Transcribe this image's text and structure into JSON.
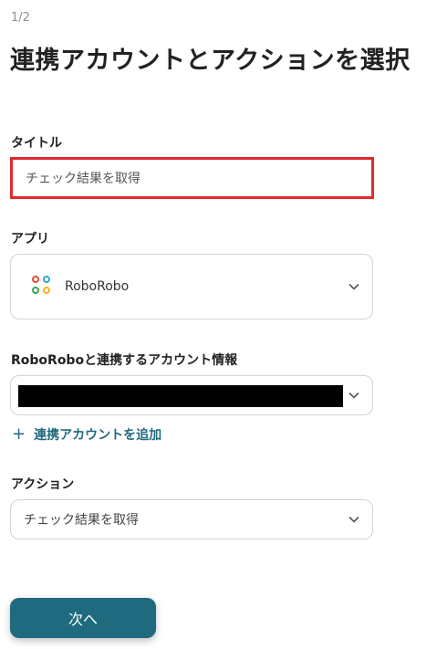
{
  "step_indicator": "1/2",
  "page_title": "連携アカウントとアクションを選択",
  "title_field": {
    "label": "タイトル",
    "value": "チェック結果を取得"
  },
  "app_field": {
    "label": "アプリ",
    "selected": "RoboRobo",
    "icon": "roborobo-logo-icon"
  },
  "account_field": {
    "label": "RoboRoboと連携するアカウント情報",
    "value_masked": true
  },
  "add_account_link": {
    "label": "連携アカウントを追加",
    "icon": "plus-icon"
  },
  "action_field": {
    "label": "アクション",
    "selected": "チェック結果を取得"
  },
  "next_button": {
    "label": "次へ"
  },
  "colors": {
    "accent": "#1f6a7e",
    "highlight_border": "#e02a2f"
  }
}
